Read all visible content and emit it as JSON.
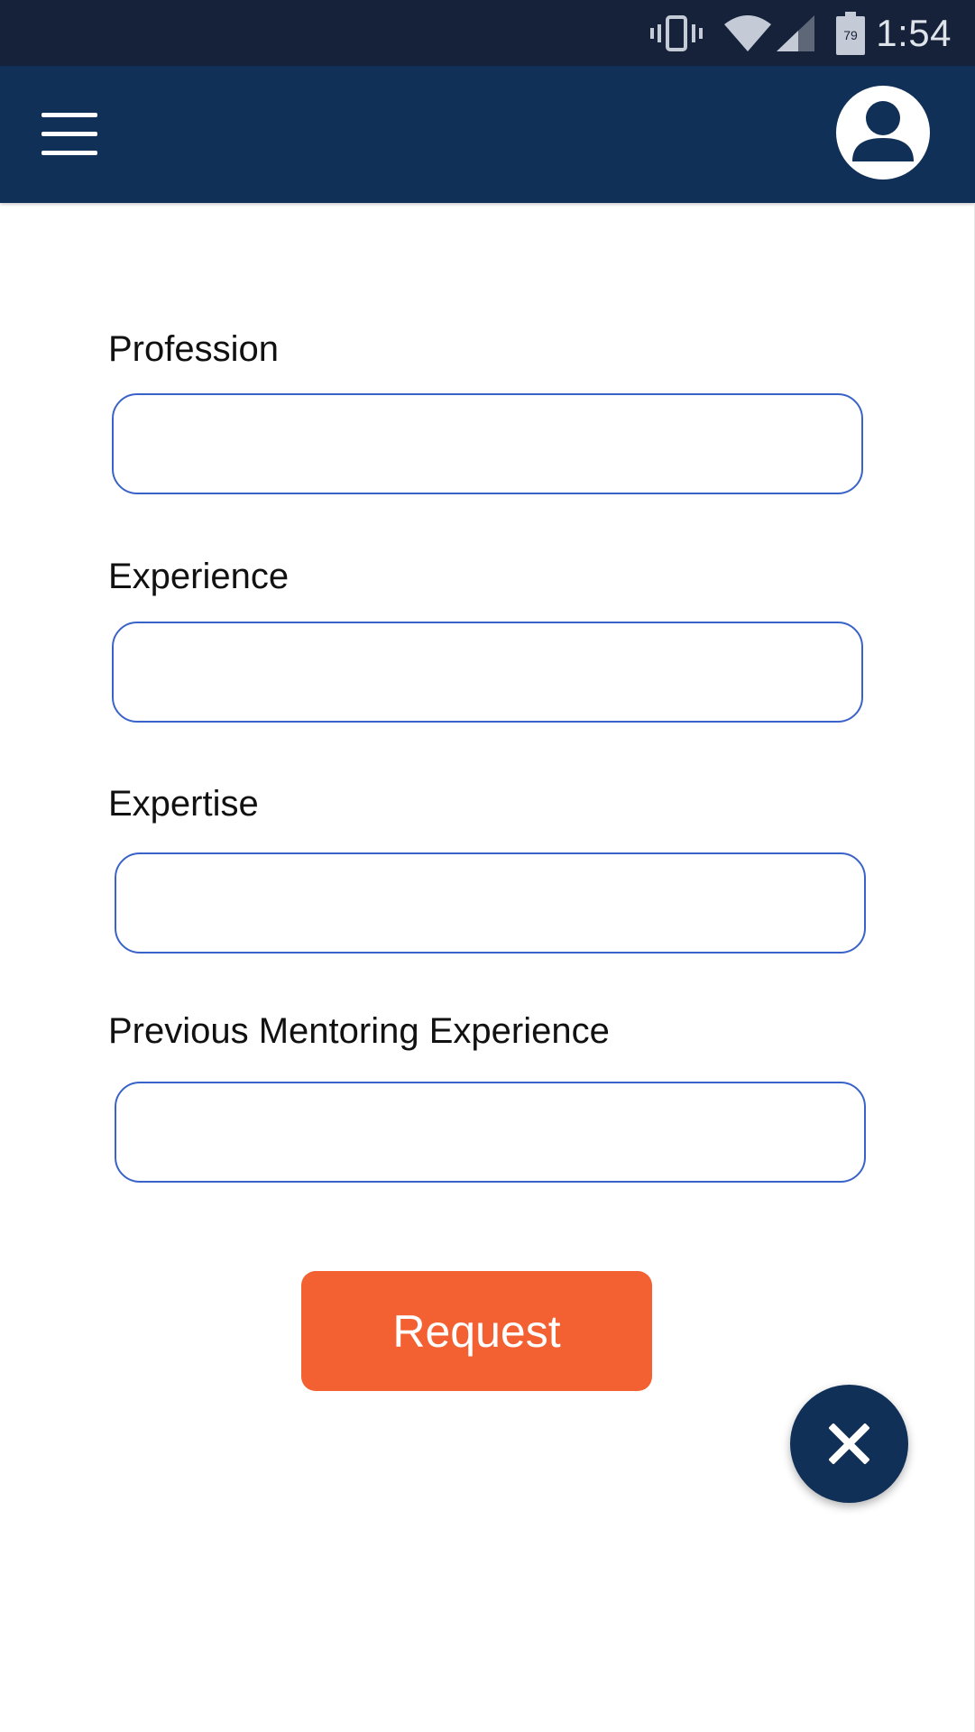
{
  "status_bar": {
    "time": "1:54",
    "battery_level": "79",
    "icons": [
      "vibrate-icon",
      "wifi-icon",
      "cell-signal-icon",
      "battery-icon"
    ]
  },
  "app_bar": {
    "menu_icon": "hamburger-menu-icon",
    "profile_icon": "user-avatar-icon",
    "background_color": "#113058"
  },
  "form": {
    "fields": [
      {
        "label": "Profession",
        "value": "",
        "placeholder": ""
      },
      {
        "label": "Experience",
        "value": "",
        "placeholder": ""
      },
      {
        "label": "Expertise",
        "value": "",
        "placeholder": ""
      },
      {
        "label": "Previous Mentoring Experience",
        "value": "",
        "placeholder": ""
      }
    ],
    "input_border_color": "#3a63c9"
  },
  "actions": {
    "request_label": "Request",
    "request_color": "#f36032",
    "close_icon": "close-icon",
    "close_color": "#113058"
  }
}
